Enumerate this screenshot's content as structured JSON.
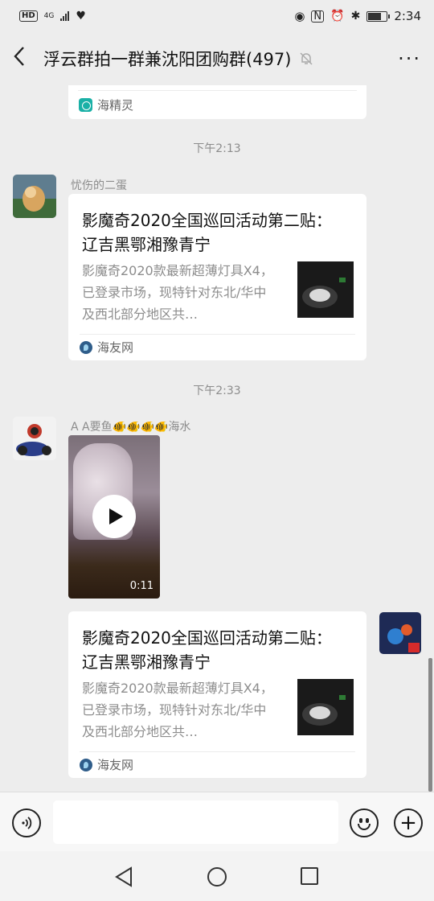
{
  "status": {
    "network": "4G",
    "network_sub": "⁴⁶",
    "time": "2:34",
    "hd": "HD"
  },
  "header": {
    "back_icon": "chevron-left-icon",
    "title": "浮云群拍一群兼沈阳团购群(497)",
    "more": "···"
  },
  "chat": {
    "top_card": {
      "source": "海精灵"
    },
    "time1": "下午2:13",
    "msg1": {
      "sender": "忧伤的二蛋",
      "title": "影魔奇2020全国巡回活动第二贴： 辽吉黑鄂湘豫青宁",
      "desc": "影魔奇2020款最新超薄灯具X4，已登录市场，现特针对东北/华中及西北部分地区共…",
      "source": "海友网"
    },
    "time2": "下午2:33",
    "msg2": {
      "sender": "A  A要鱼🐠🐠🐠🐠海水",
      "video_duration": "0:11"
    },
    "msg3": {
      "title": "影魔奇2020全国巡回活动第二贴： 辽吉黑鄂湘豫青宁",
      "desc": "影魔奇2020款最新超薄灯具X4，已登录市场，现特针对东北/华中及西北部分地区共…",
      "source": "海友网"
    }
  },
  "input": {
    "voice_icon": "voice-icon",
    "emoji_icon": "emoji-icon",
    "plus_icon": "plus-icon"
  },
  "colors": {
    "bg": "#ededed",
    "card": "#ffffff",
    "meta_text": "#8c8c8c"
  }
}
